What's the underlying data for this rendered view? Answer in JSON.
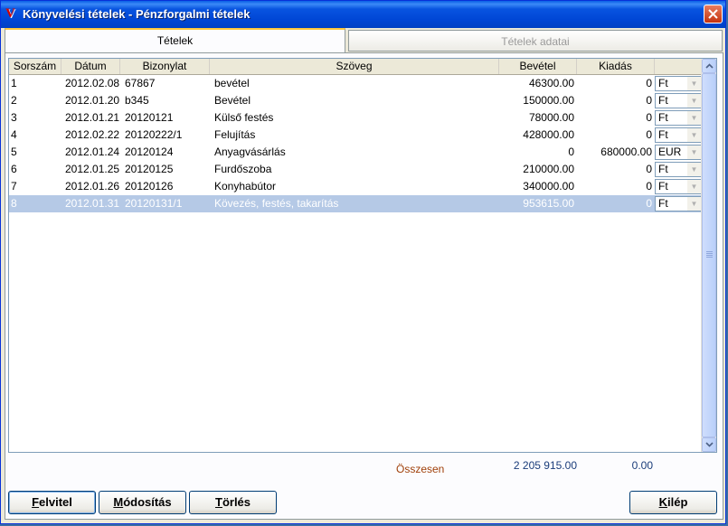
{
  "window": {
    "title": "Könyvelési tételek - Pénzforgalmi tételek"
  },
  "tabs": [
    {
      "label": "Tételek",
      "active": true
    },
    {
      "label": "Tételek adatai",
      "active": false
    }
  ],
  "grid": {
    "columns": [
      "Sorszám",
      "Dátum",
      "Bizonylat",
      "Szöveg",
      "Bevétel",
      "Kiadás",
      ""
    ],
    "rows": [
      {
        "no": "1",
        "date": "2012.02.08",
        "doc": "67867",
        "text": "bevétel",
        "income": "46300.00",
        "expense": "0",
        "currency": "Ft"
      },
      {
        "no": "2",
        "date": "2012.01.20",
        "doc": "b345",
        "text": "Bevétel",
        "income": "150000.00",
        "expense": "0",
        "currency": "Ft"
      },
      {
        "no": "3",
        "date": "2012.01.21",
        "doc": "20120121",
        "text": "Külső festés",
        "income": "78000.00",
        "expense": "0",
        "currency": "Ft"
      },
      {
        "no": "4",
        "date": "2012.02.22",
        "doc": "20120222/1",
        "text": "Felujítás",
        "income": "428000.00",
        "expense": "0",
        "currency": "Ft"
      },
      {
        "no": "5",
        "date": "2012.01.24",
        "doc": "20120124",
        "text": "Anyagvásárlás",
        "income": "0",
        "expense": "680000.00",
        "currency": "EUR"
      },
      {
        "no": "6",
        "date": "2012.01.25",
        "doc": "20120125",
        "text": "Furdőszoba",
        "income": "210000.00",
        "expense": "0",
        "currency": "Ft"
      },
      {
        "no": "7",
        "date": "2012.01.26",
        "doc": "20120126",
        "text": "Konyhabútor",
        "income": "340000.00",
        "expense": "0",
        "currency": "Ft"
      },
      {
        "no": "8",
        "date": "2012.01.31",
        "doc": "20120131/1",
        "text": "Kövezés, festés, takarítás",
        "income": "953615.00",
        "expense": "0",
        "currency": "Ft",
        "selected": true
      }
    ]
  },
  "totals": {
    "label": "Összesen",
    "income": "2 205 915.00",
    "expense": "0.00"
  },
  "buttons": {
    "new_key": "F",
    "new_rest": "elvitel",
    "edit_key": "M",
    "edit_rest": "ódosítás",
    "delete_key": "T",
    "delete_rest": "örlés",
    "exit_key": "K",
    "exit_rest": "ilép"
  },
  "colors": {
    "titlebar": "#0046d5",
    "selection": "#b5c9e6",
    "total_label": "#a0400a",
    "total_value": "#1a3c7a"
  },
  "icons": {
    "app": "app-logo-icon",
    "close": "close-icon",
    "scroll_up": "chevron-up-icon",
    "scroll_down": "chevron-down-icon",
    "dropdown": "chevron-down-icon"
  }
}
